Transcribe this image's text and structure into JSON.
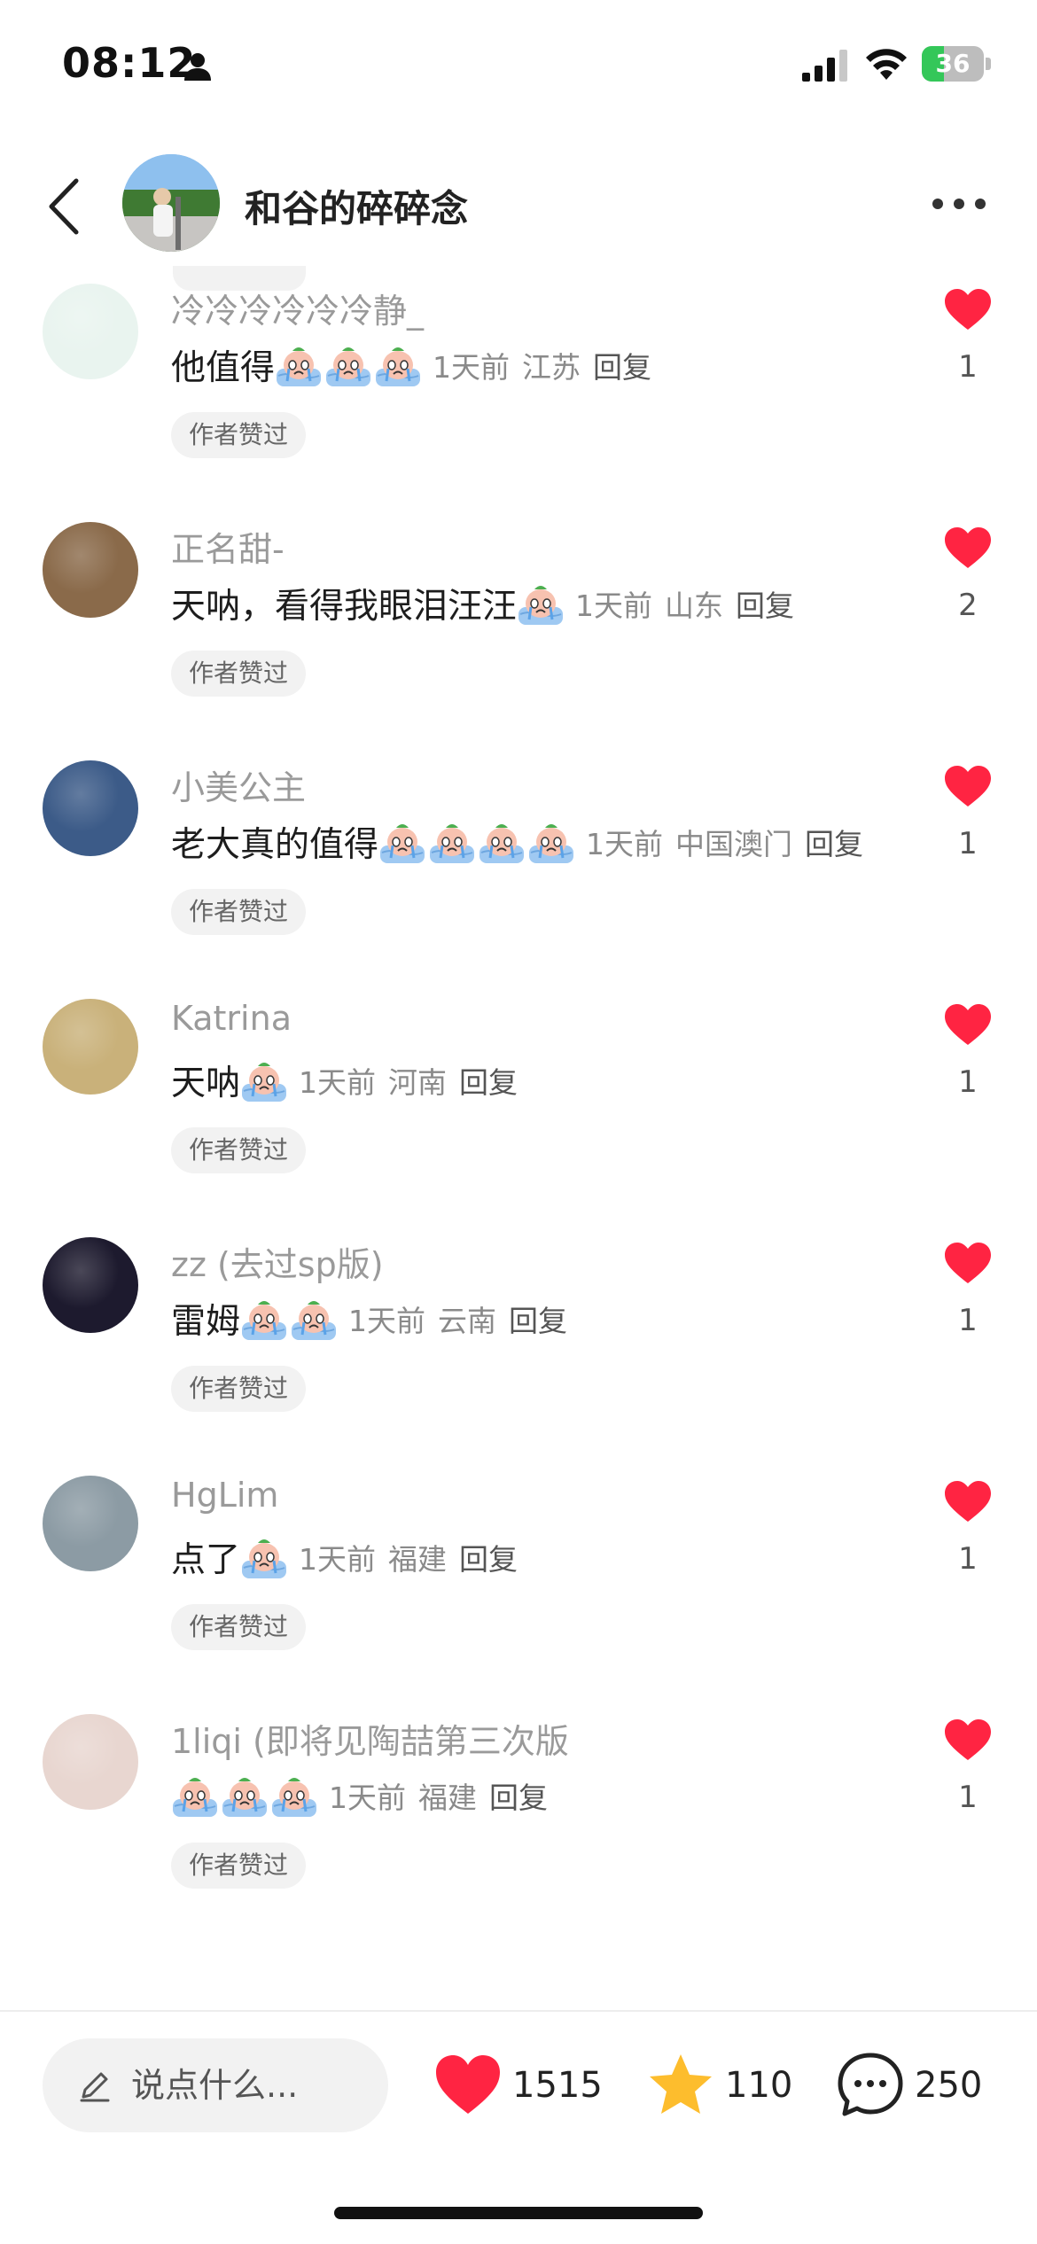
{
  "status_bar": {
    "time": "08:12",
    "battery_level": "36",
    "battery_fraction": 0.36,
    "icons": [
      "person-icon",
      "signal-icon",
      "wifi-icon",
      "battery-charging-icon"
    ]
  },
  "header": {
    "title": "和谷的碎碎念",
    "back_icon": "chevron-left-icon",
    "more_icon": "more-horizontal-icon"
  },
  "comments": [
    {
      "username": "冷冷冷冷冷冷静_",
      "text": "他值得",
      "emoji_count": 3,
      "time": "1天前",
      "location": "江苏",
      "reply": "回复",
      "badge": "作者赞过",
      "likes": "1",
      "avatar_color": "#e9f4ef"
    },
    {
      "username": "正名甜-",
      "text": "天呐，看得我眼泪汪汪",
      "emoji_count": 1,
      "time": "1天前",
      "location": "山东",
      "reply": "回复",
      "badge": "作者赞过",
      "likes": "2",
      "avatar_color": "#8a6a4a"
    },
    {
      "username": "小美公主",
      "text": "老大真的值得",
      "emoji_count": 4,
      "time": "1天前",
      "location": "中国澳门",
      "reply": "回复",
      "badge": "作者赞过",
      "likes": "1",
      "avatar_color": "#3c5b88"
    },
    {
      "username": "Katrina",
      "text": "天呐",
      "emoji_count": 1,
      "time": "1天前",
      "location": "河南",
      "reply": "回复",
      "badge": "作者赞过",
      "likes": "1",
      "avatar_color": "#c9b17a"
    },
    {
      "username": "zz (去过sp版)",
      "text": "雷姆",
      "emoji_count": 2,
      "time": "1天前",
      "location": "云南",
      "reply": "回复",
      "badge": "作者赞过",
      "likes": "1",
      "avatar_color": "#1d1a2e"
    },
    {
      "username": "HgLim",
      "text": "点了",
      "emoji_count": 1,
      "time": "1天前",
      "location": "福建",
      "reply": "回复",
      "badge": "作者赞过",
      "likes": "1",
      "avatar_color": "#8c9ba4"
    },
    {
      "username": "1liqi (即将见陶喆第三次版",
      "text": "",
      "emoji_count": 3,
      "time": "1天前",
      "location": "福建",
      "reply": "回复",
      "badge": "作者赞过",
      "likes": "1",
      "avatar_color": "#e8d6d0"
    }
  ],
  "bottom_bar": {
    "input_placeholder": "说点什么...",
    "likes": "1515",
    "favorites": "110",
    "comments": "250",
    "like_color": "#ff2442",
    "favorite_color": "#fdbd2d"
  },
  "colors": {
    "like_red": "#ff2442",
    "battery_green": "#34c759"
  }
}
